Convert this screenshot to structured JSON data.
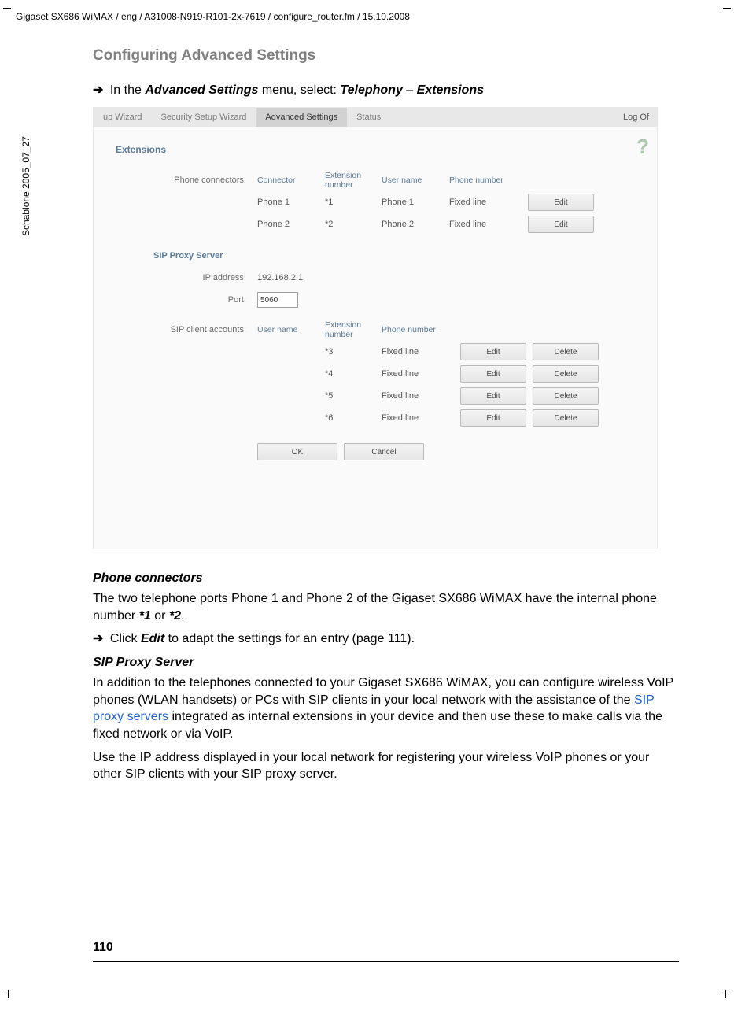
{
  "meta": {
    "header_path": "Gigaset SX686 WiMAX / eng / A31008-N919-R101-2x-7619 / configure_router.fm / 15.10.2008",
    "side_text": "Schablone 2005_07_27",
    "page_number": "110"
  },
  "section_title": "Configuring Advanced Settings",
  "intro": {
    "prefix": "In the ",
    "bold1": "Advanced Settings",
    "mid": " menu, select: ",
    "bold2": "Telephony",
    "dash": " – ",
    "bold3": "Extensions"
  },
  "screenshot": {
    "tabs": {
      "t1": "up Wizard",
      "t2": "Security Setup Wizard",
      "t3": "Advanced Settings",
      "t4": "Status"
    },
    "logoff": "Log Of",
    "help": "?",
    "heading": "Extensions",
    "phone_connectors": {
      "label": "Phone connectors:",
      "hdr_connector": "Connector",
      "hdr_ext": "Extension number",
      "hdr_user": "User name",
      "hdr_phone": "Phone number",
      "rows": [
        {
          "connector": "Phone 1",
          "ext": "*1",
          "user": "Phone 1",
          "phone": "Fixed line",
          "edit": "Edit"
        },
        {
          "connector": "Phone 2",
          "ext": "*2",
          "user": "Phone 2",
          "phone": "Fixed line",
          "edit": "Edit"
        }
      ]
    },
    "sip_proxy": {
      "title": "SIP Proxy Server",
      "ip_label": "IP address:",
      "ip_value": "192.168.2.1",
      "port_label": "Port:",
      "port_value": "5060"
    },
    "sip_clients": {
      "label": "SIP client accounts:",
      "hdr_user": "User name",
      "hdr_ext": "Extension number",
      "hdr_phone": "Phone number",
      "rows": [
        {
          "ext": "*3",
          "phone": "Fixed line",
          "edit": "Edit",
          "delete": "Delete"
        },
        {
          "ext": "*4",
          "phone": "Fixed line",
          "edit": "Edit",
          "delete": "Delete"
        },
        {
          "ext": "*5",
          "phone": "Fixed line",
          "edit": "Edit",
          "delete": "Delete"
        },
        {
          "ext": "*6",
          "phone": "Fixed line",
          "edit": "Edit",
          "delete": "Delete"
        }
      ]
    },
    "ok": "OK",
    "cancel": "Cancel"
  },
  "body": {
    "h_phone": "Phone connectors",
    "p1a": "The two telephone ports Phone 1 and Phone 2 of the Gigaset SX686 WiMAX have the internal phone number ",
    "p1b": "*1",
    "p1c": " or ",
    "p1d": "*2",
    "p1e": ".",
    "arrow2a": "Click ",
    "arrow2b": "Edit",
    "arrow2c": " to adapt the settings for an entry (page 111).",
    "h_sip": "SIP Proxy Server",
    "p2a": "In addition to the telephones connected to your Gigaset SX686 WiMAX, you can configure wireless VoIP phones (WLAN handsets) or PCs with SIP clients in your local network with the assistance of the ",
    "p2link": "SIP proxy servers",
    "p2b": " integrated as internal extensions in your device and then use these to make calls via the fixed network or via VoIP.",
    "p3": "Use the IP address displayed in your local network for registering your wireless VoIP phones or your other SIP clients with your SIP proxy server."
  }
}
